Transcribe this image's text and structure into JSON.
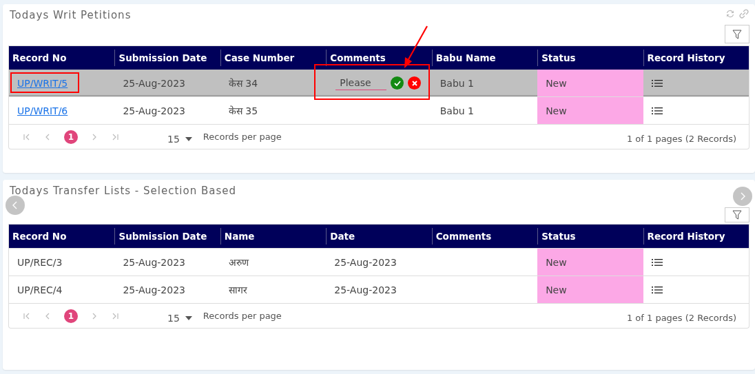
{
  "panels": [
    {
      "title": "Todays Writ Petitions",
      "annotations": [
        {
          "kind": "arrow"
        }
      ],
      "carousel": false,
      "columns": [
        "Record No",
        "Submission Date",
        "Case Number",
        "Comments",
        "Babu Name",
        "Status",
        "Record History"
      ],
      "rows": [
        {
          "selected": true,
          "cells": [
            {
              "kind": "link",
              "text": "UP/WRIT/5",
              "highlighted": true
            },
            {
              "kind": "text",
              "text": "25-Aug-2023"
            },
            {
              "kind": "text",
              "text": "केस 34"
            },
            {
              "kind": "editor",
              "value": "Please",
              "highlighted": true
            },
            {
              "kind": "text",
              "text": "Babu 1"
            },
            {
              "kind": "status",
              "text": "New"
            },
            {
              "kind": "history"
            }
          ]
        },
        {
          "selected": false,
          "cells": [
            {
              "kind": "link",
              "text": "UP/WRIT/6"
            },
            {
              "kind": "text",
              "text": "25-Aug-2023"
            },
            {
              "kind": "text",
              "text": "केस 35"
            },
            {
              "kind": "text",
              "text": ""
            },
            {
              "kind": "text",
              "text": "Babu 1"
            },
            {
              "kind": "status",
              "text": "New"
            },
            {
              "kind": "history"
            }
          ]
        }
      ],
      "pager": {
        "pages": [
          {
            "label": "1",
            "selected": true
          }
        ],
        "page_size": "15",
        "per_page_label": "Records per page",
        "summary": "1 of 1 pages (2 Records)"
      }
    },
    {
      "title": "Todays Transfer Lists - Selection Based",
      "carousel": true,
      "columns": [
        "Record No",
        "Submission Date",
        "Name",
        "Date",
        "Comments",
        "Status",
        "Record History"
      ],
      "rows": [
        {
          "selected": false,
          "cells": [
            {
              "kind": "text",
              "text": "UP/REC/3"
            },
            {
              "kind": "text",
              "text": "25-Aug-2023"
            },
            {
              "kind": "text",
              "text": "अरुण"
            },
            {
              "kind": "text",
              "text": "25-Aug-2023"
            },
            {
              "kind": "text",
              "text": ""
            },
            {
              "kind": "status",
              "text": "New"
            },
            {
              "kind": "history"
            }
          ]
        },
        {
          "selected": false,
          "cells": [
            {
              "kind": "text",
              "text": "UP/REC/4"
            },
            {
              "kind": "text",
              "text": "25-Aug-2023"
            },
            {
              "kind": "text",
              "text": "सागर"
            },
            {
              "kind": "text",
              "text": "25-Aug-2023"
            },
            {
              "kind": "text",
              "text": ""
            },
            {
              "kind": "status",
              "text": "New"
            },
            {
              "kind": "history"
            }
          ]
        }
      ],
      "pager": {
        "pages": [
          {
            "label": "1",
            "selected": true
          }
        ],
        "page_size": "15",
        "per_page_label": "Records per page",
        "summary": "1 of 1 pages (2 Records)"
      }
    }
  ]
}
